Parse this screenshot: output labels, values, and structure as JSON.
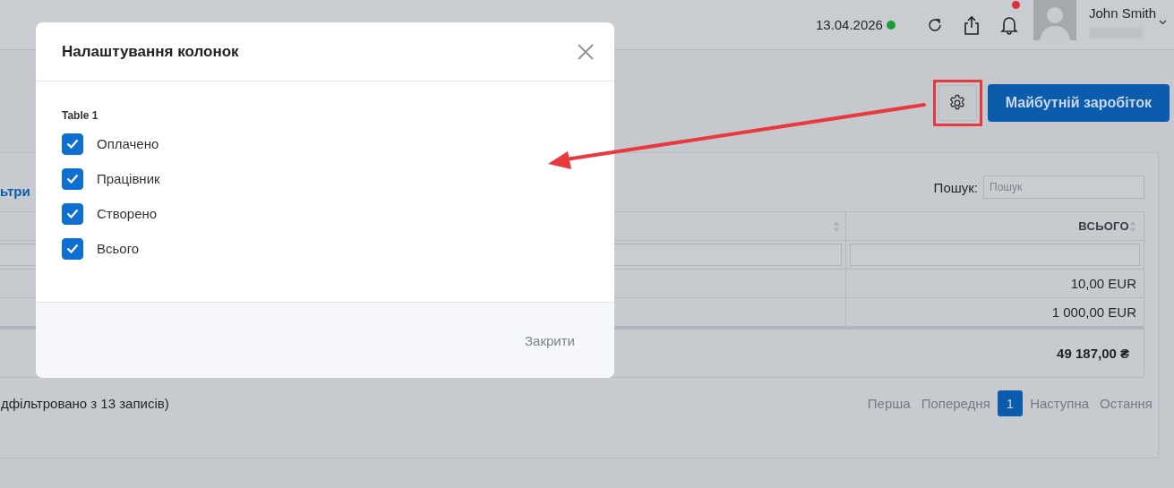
{
  "header": {
    "date": "13.04.2026",
    "online": true,
    "unread": true,
    "user_name": "John Smith"
  },
  "toolbar": {
    "settings_highlighted": true,
    "primary_button": "Майбутній заробіток"
  },
  "card": {
    "filter_link": "ьтри",
    "search_label": "Пошук:",
    "search_placeholder": "Пошук"
  },
  "table": {
    "total_heading": "ВСЬОГО",
    "rows": [
      {
        "total": "10,00 EUR"
      },
      {
        "total": "1 000,00 EUR"
      }
    ],
    "footer_total": "49 187,00 ₴"
  },
  "info": "дфільтровано з 13 записів)",
  "pagination": [
    {
      "label": "Перша",
      "selected": false
    },
    {
      "label": "Попередня",
      "selected": false
    },
    {
      "label": "1",
      "selected": true
    },
    {
      "label": "Наступна",
      "selected": false
    },
    {
      "label": "Остання",
      "selected": false
    }
  ],
  "modal": {
    "title": "Налаштування колонок",
    "group": "Table 1",
    "options": [
      {
        "label": "Оплачено",
        "checked": true
      },
      {
        "label": "Працівник",
        "checked": true
      },
      {
        "label": "Створено",
        "checked": true
      },
      {
        "label": "Всього",
        "checked": true
      }
    ],
    "close_label": "Закрити"
  }
}
